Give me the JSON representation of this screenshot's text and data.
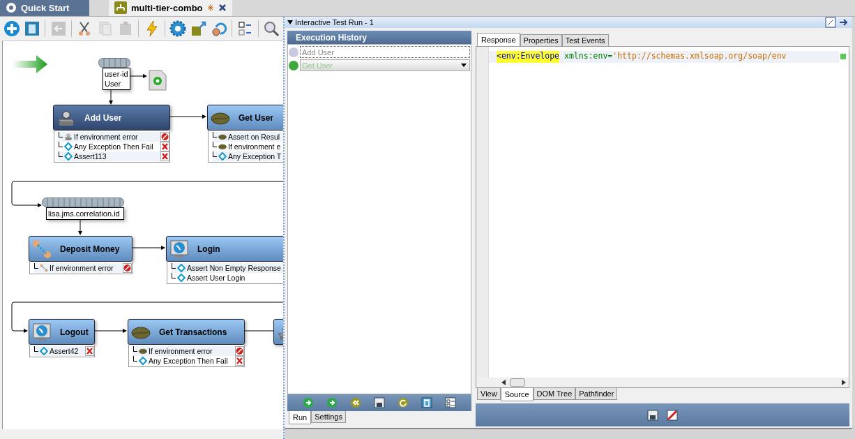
{
  "tabs": [
    {
      "label": "Quick Start",
      "selected": false,
      "kind": "start"
    },
    {
      "label": "multi-tier-combo",
      "selected": true,
      "kind": "document",
      "modified": true
    }
  ],
  "toolbar": [
    {
      "kind": "add",
      "disabled": false
    },
    {
      "kind": "delete",
      "disabled": false
    },
    {
      "kind": "back",
      "disabled": true
    },
    {
      "kind": "cut",
      "disabled": false
    },
    {
      "kind": "copy",
      "disabled": true
    },
    {
      "kind": "paste",
      "disabled": true
    },
    {
      "kind": "run",
      "disabled": false
    },
    {
      "kind": "settings",
      "disabled": false
    },
    {
      "kind": "export",
      "disabled": false
    },
    {
      "kind": "refresh",
      "disabled": false
    },
    {
      "kind": "checklist",
      "disabled": false
    },
    {
      "kind": "search",
      "disabled": false
    }
  ],
  "canvas": {
    "datasets": [
      {
        "lines": [
          "user-id",
          "User"
        ]
      },
      {
        "lines": [
          "lisa.jms.correlation.id"
        ]
      }
    ],
    "nodes": [
      {
        "title": "Add User",
        "kind": "anvil",
        "selected": true,
        "assertions": [
          {
            "label": "If environment error",
            "kind": "anvil",
            "halts": true,
            "fails": false
          },
          {
            "label": "Any Exception Then Fail",
            "kind": "diamond",
            "halts": false,
            "fails": true
          },
          {
            "label": "Assert113",
            "kind": "diamond",
            "halts": false,
            "fails": true
          }
        ]
      },
      {
        "title": "Get User",
        "kind": "bean",
        "selected": false,
        "assertions": [
          {
            "label": "Assert on Resul",
            "kind": "bean"
          },
          {
            "label": "If environment e",
            "kind": "bean"
          },
          {
            "label": "Any Exception T",
            "kind": "diamond"
          }
        ]
      },
      {
        "title": "Deposit Money",
        "kind": "transfer",
        "selected": false,
        "assertions": [
          {
            "label": "If environment error",
            "kind": "transfer",
            "halts": true,
            "fails": false
          }
        ]
      },
      {
        "title": "Login",
        "kind": "monitor",
        "selected": false,
        "assertions": [
          {
            "label": "Assert Non Empty Response",
            "kind": "diamond"
          },
          {
            "label": "Assert User Login",
            "kind": "diamond"
          }
        ]
      },
      {
        "title": "Logout",
        "kind": "monitor",
        "selected": false,
        "assertions": [
          {
            "label": "Assert42",
            "kind": "diamond",
            "halts": false,
            "fails": true
          }
        ]
      },
      {
        "title": "Get Transactions",
        "kind": "bean",
        "selected": false,
        "assertions": [
          {
            "label": "If environment error",
            "kind": "bean",
            "halts": true,
            "fails": false
          },
          {
            "label": "Any Exception Then Fail",
            "kind": "diamond",
            "halts": false,
            "fails": true
          }
        ]
      },
      {
        "kind": "anvil",
        "selected": false
      }
    ]
  },
  "run_panel": {
    "title": "Interactive Test Run - 1",
    "history": {
      "title": "Execution History",
      "items": [
        {
          "label": "Add User",
          "color": "#c8cbe0",
          "dropdown": false
        },
        {
          "label": "Get User",
          "color": "#3fa83f",
          "dropdown": true
        }
      ],
      "toolbar": [
        {
          "kind": "step"
        },
        {
          "kind": "go"
        },
        {
          "kind": "rewind"
        },
        {
          "kind": "save"
        },
        {
          "kind": "reload"
        },
        {
          "kind": "delete"
        },
        {
          "kind": "checklist"
        }
      ],
      "tabs": [
        {
          "label": "Run",
          "selected": true
        },
        {
          "label": "Settings",
          "selected": false
        }
      ]
    },
    "response": {
      "tabs": [
        {
          "label": "Response",
          "selected": true
        },
        {
          "label": "Properties",
          "selected": false
        },
        {
          "label": "Test Events",
          "selected": false
        }
      ],
      "code": [
        {
          "kind": "tag",
          "text": "<env:Envelope"
        },
        {
          "kind": "attr",
          "text": "xmlns:env="
        },
        {
          "kind": "value",
          "text": "'http://schemas.xmlsoap.org/soap/env"
        }
      ],
      "view_tabs": [
        {
          "label": "View",
          "selected": false
        },
        {
          "label": "Source",
          "selected": true
        },
        {
          "label": "DOM Tree",
          "selected": false
        },
        {
          "label": "Pathfinder",
          "selected": false
        }
      ],
      "toolbar": [
        {
          "kind": "save"
        },
        {
          "kind": "no-image"
        }
      ]
    }
  }
}
